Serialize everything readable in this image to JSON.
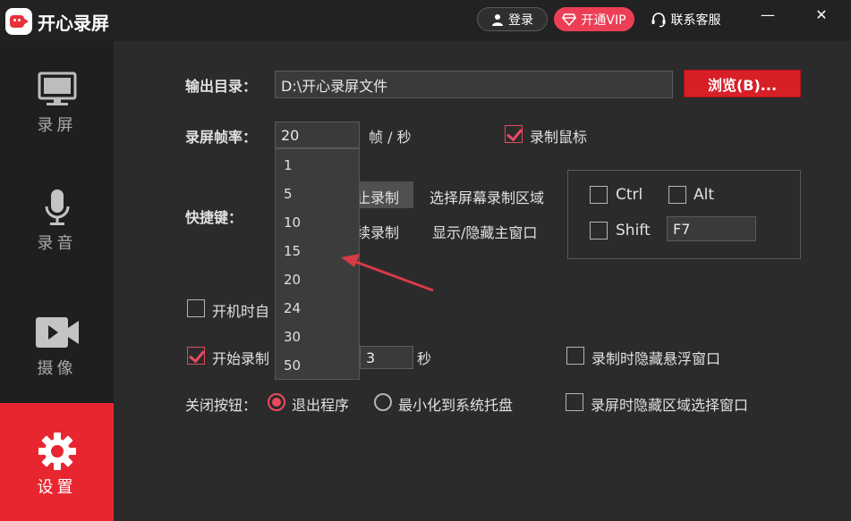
{
  "app": {
    "title": "开心录屏"
  },
  "titlebar": {
    "login_label": "登录",
    "vip_label": "开通VIP",
    "service_label": "联系客服",
    "minimize": "—",
    "close": "✕"
  },
  "sidebar": {
    "items": [
      {
        "label": "录屏",
        "icon": "monitor-icon"
      },
      {
        "label": "录音",
        "icon": "microphone-icon"
      },
      {
        "label": "摄像",
        "icon": "video-camera-icon"
      },
      {
        "label": "设置",
        "icon": "gear-icon",
        "active": true
      }
    ]
  },
  "settings": {
    "output_dir_label": "输出目录：",
    "output_dir_value": "D:\\开心录屏文件",
    "browse_label": "浏览(B)...",
    "fps_label": "录屏帧率：",
    "fps_value": "20",
    "fps_unit": "帧 / 秒",
    "record_mouse_label": "录制鼠标",
    "record_mouse_checked": true,
    "hotkey_label": "快捷键：",
    "hotkey_action_1_partial": "止录制",
    "hotkey_action_2_partial": "续录制",
    "hotkey_select_region": "选择屏幕录制区域",
    "hotkey_toggle_window": "显示/隐藏主窗口",
    "mod_ctrl": "Ctrl",
    "mod_alt": "Alt",
    "mod_shift": "Shift",
    "hotkey_key_value": "F7",
    "autostart_label_partial": "开机时自",
    "countdown_label_partial": "开始录制",
    "countdown_checked": true,
    "countdown_value": "3",
    "countdown_unit": "秒",
    "hide_float_label": "录制时隐藏悬浮窗口",
    "close_btn_label": "关闭按钮：",
    "exit_app_label": "退出程序",
    "minimize_tray_label": "最小化到系统托盘",
    "hide_region_label": "录屏时隐藏区域选择窗口"
  },
  "fps_dropdown": {
    "options": [
      "1",
      "5",
      "10",
      "15",
      "20",
      "24",
      "30",
      "50"
    ],
    "selected": "20"
  },
  "colors": {
    "accent": "#e8262f",
    "vip": "#ec3f55",
    "check": "#ec4a5e"
  }
}
